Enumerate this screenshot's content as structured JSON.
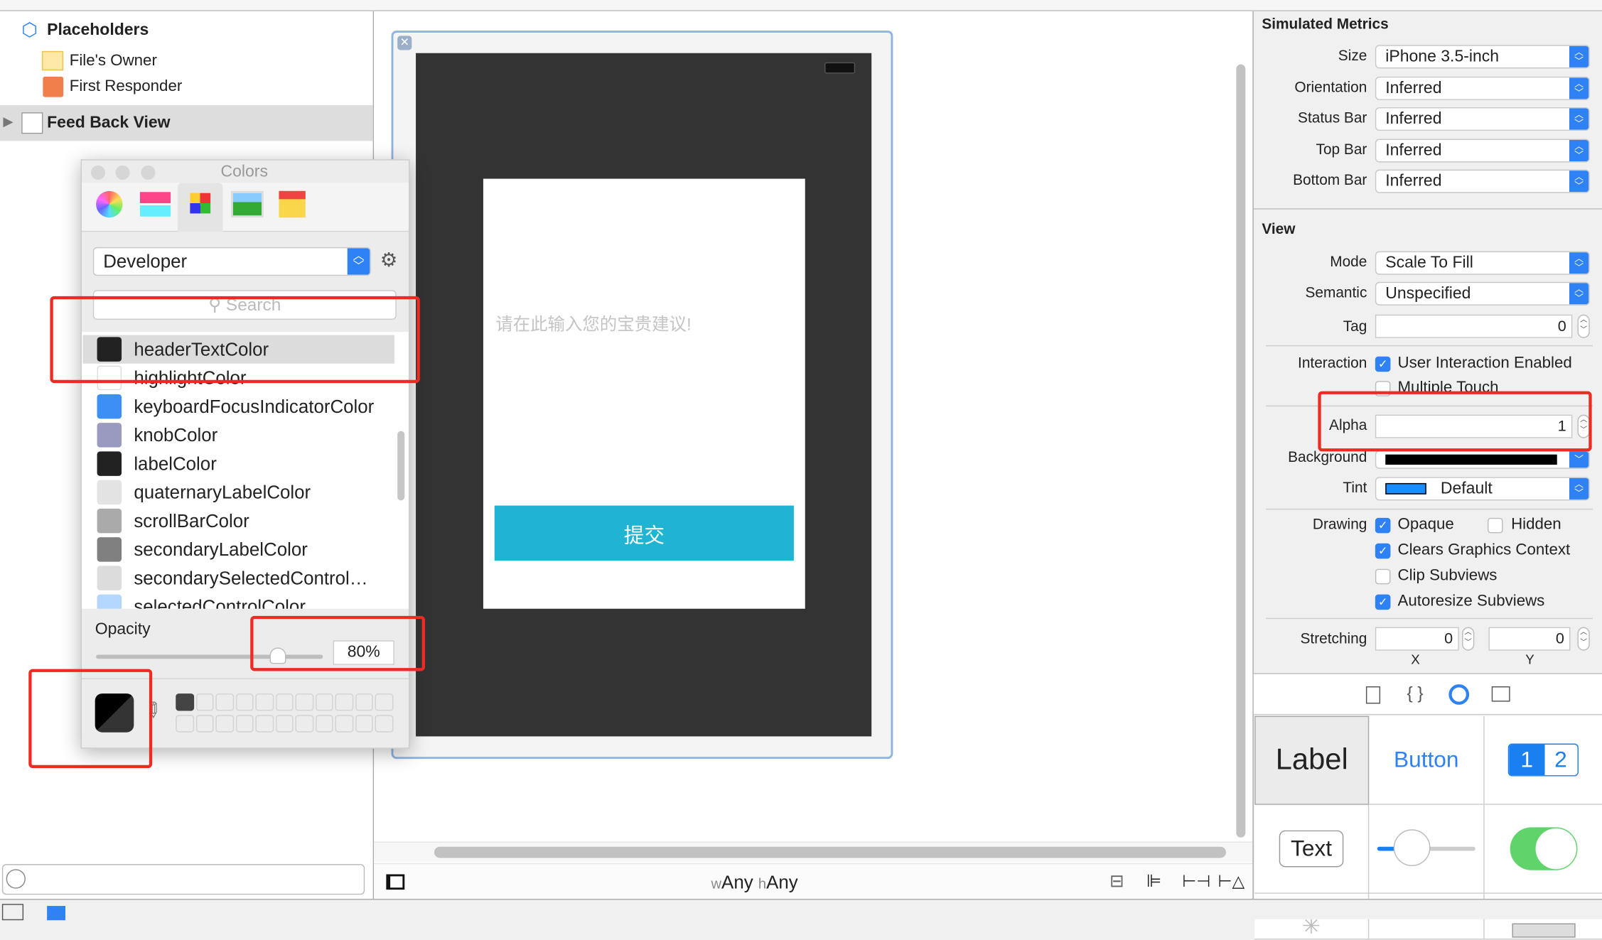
{
  "outline": {
    "placeholders": "Placeholders",
    "files_owner": "File's Owner",
    "first_responder": "First Responder",
    "feed_back_view": "Feed Back View"
  },
  "colors_panel": {
    "title": "Colors",
    "palette": "Developer",
    "search_placeholder": "Search",
    "items": [
      {
        "name": "headerTextColor",
        "color": "#222222"
      },
      {
        "name": "highlightColor",
        "color": "#ffffff"
      },
      {
        "name": "keyboardFocusIndicatorColor",
        "color": "#3d8ef5"
      },
      {
        "name": "knobColor",
        "color": "#9a9ac0"
      },
      {
        "name": "labelColor",
        "color": "#222222"
      },
      {
        "name": "quaternaryLabelColor",
        "color": "#e3e3e3"
      },
      {
        "name": "scrollBarColor",
        "color": "#aaaaaa"
      },
      {
        "name": "secondaryLabelColor",
        "color": "#808080"
      },
      {
        "name": "secondarySelectedControl…",
        "color": "#dcdcdc"
      },
      {
        "name": "selectedControlColor",
        "color": "#b3d7ff"
      }
    ],
    "selected_item": "headerTextColor",
    "opacity_label": "Opacity",
    "opacity_value": "80%",
    "opacity_percent": 80
  },
  "canvas": {
    "placeholder_text": "请在此输入您的宝贵建议!",
    "submit_button": "提交",
    "submit_color": "#1fb5d2",
    "size_class_w_prefix": "w",
    "size_class_w": "Any",
    "size_class_h_prefix": "h",
    "size_class_h": "Any"
  },
  "inspector": {
    "simulated_metrics": "Simulated Metrics",
    "size_label": "Size",
    "size_value": "iPhone 3.5-inch",
    "orientation_label": "Orientation",
    "orientation_value": "Inferred",
    "status_bar_label": "Status Bar",
    "status_bar_value": "Inferred",
    "top_bar_label": "Top Bar",
    "top_bar_value": "Inferred",
    "bottom_bar_label": "Bottom Bar",
    "bottom_bar_value": "Inferred",
    "view": "View",
    "mode_label": "Mode",
    "mode_value": "Scale To Fill",
    "semantic_label": "Semantic",
    "semantic_value": "Unspecified",
    "tag_label": "Tag",
    "tag_value": "0",
    "interaction_label": "Interaction",
    "user_interaction": "User Interaction Enabled",
    "multiple_touch": "Multiple Touch",
    "alpha_label": "Alpha",
    "alpha_value": "1",
    "background_label": "Background",
    "tint_label": "Tint",
    "tint_value": "Default",
    "tint_color": "#1a8cff",
    "drawing_label": "Drawing",
    "opaque": "Opaque",
    "hidden": "Hidden",
    "clears_graphics": "Clears Graphics Context",
    "clip_subviews": "Clip Subviews",
    "autoresize": "Autoresize Subviews",
    "stretching_label": "Stretching",
    "stretch_x": "0",
    "stretch_y": "0",
    "x_label": "X",
    "y_label": "Y"
  },
  "library": {
    "label": "Label",
    "button": "Button",
    "seg1": "1",
    "seg2": "2",
    "text": "Text"
  }
}
